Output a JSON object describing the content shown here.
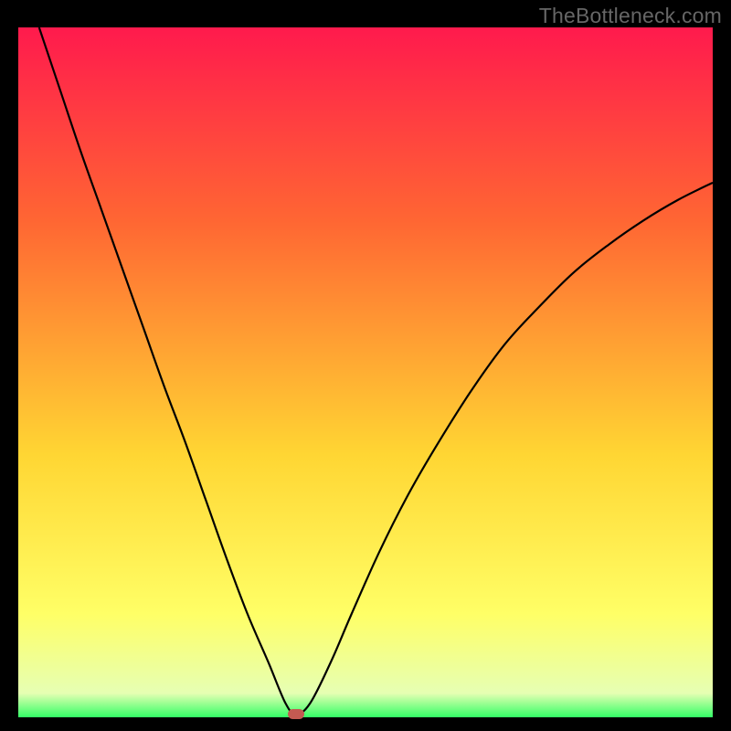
{
  "watermark": "TheBottleneck.com",
  "chart_data": {
    "type": "line",
    "title": "",
    "xlabel": "",
    "ylabel": "",
    "xlim": [
      0,
      100
    ],
    "ylim": [
      0,
      100
    ],
    "grid": false,
    "background_gradient": [
      "#ff1a4d",
      "#ff6633",
      "#ffd633",
      "#ffff66",
      "#e6ffb3",
      "#33ff66"
    ],
    "series": [
      {
        "name": "curve",
        "color": "#000000",
        "x": [
          3,
          6,
          9,
          12,
          15,
          18,
          21,
          24,
          27,
          30,
          33,
          36,
          38.5,
          40,
          42,
          45,
          48,
          52,
          56,
          60,
          65,
          70,
          75,
          80,
          85,
          90,
          95,
          100
        ],
        "y": [
          100,
          91,
          82,
          73.5,
          65,
          56.5,
          48,
          40,
          31.5,
          23,
          15,
          8,
          2,
          0.5,
          2,
          8,
          15,
          24,
          32,
          39,
          47,
          54,
          59.5,
          64.5,
          68.5,
          72,
          75,
          77.5
        ]
      }
    ],
    "marker": {
      "x": 40,
      "y": 0.5,
      "color": "#c35a52"
    }
  }
}
